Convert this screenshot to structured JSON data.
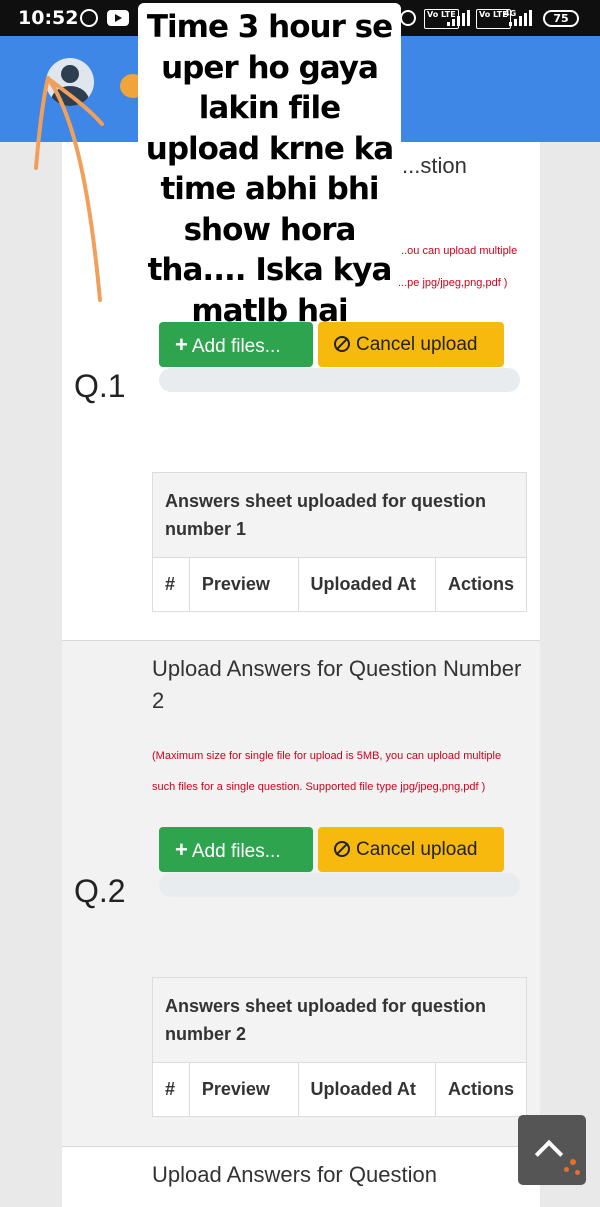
{
  "status_bar": {
    "time": "10:52",
    "icons": [
      "whatsapp-icon",
      "youtube-icon",
      "alarm-icon",
      "volte-icon",
      "signal-icon",
      "volte-icon",
      "4g-signal-icon"
    ],
    "volte_label": "Vo LTE",
    "network_label": "4G",
    "battery": "75"
  },
  "header": {
    "color": "#3f87e6"
  },
  "overlay_note": {
    "text": "Time 3 hour se uper ho gaya lakin file upload krne ka time abhi bhi show hora tha.... Iska kya matlb hai",
    "arrow_color": "#f0a05a"
  },
  "questions": [
    {
      "label": "Q.1",
      "title": "...stion",
      "note_line1": "...ou can upload multiple",
      "note_line2": "...pe jpg/jpeg,png,pdf )",
      "add_files_label": "Add files...",
      "cancel_label": "Cancel upload",
      "table_caption": "Answers sheet uploaded for question number 1",
      "columns": [
        "#",
        "Preview",
        "Uploaded At",
        "Actions"
      ]
    },
    {
      "label": "Q.2",
      "title": "Upload Answers for Question Number 2",
      "note_line1": "(Maximum size for single file for upload is 5MB, you can upload multiple",
      "note_line2": "such files for a single question. Supported file type jpg/jpeg,png,pdf )",
      "add_files_label": "Add files...",
      "cancel_label": "Cancel upload",
      "table_caption": "Answers sheet uploaded for question number 2",
      "columns": [
        "#",
        "Preview",
        "Uploaded At",
        "Actions"
      ]
    },
    {
      "title": "Upload Answers for Question"
    }
  ],
  "colors": {
    "add_button": "#2ea44f",
    "cancel_button": "#f7b90e",
    "note_text": "#d0021b"
  },
  "scroll_top_icon": "chevron-up-icon"
}
